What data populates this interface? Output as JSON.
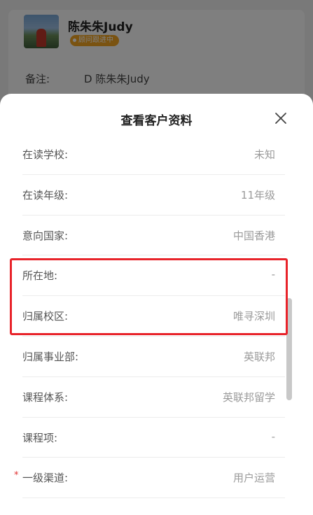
{
  "background": {
    "customer_name": "陈朱朱Judy",
    "status_badge": "顾问跟进中",
    "remark_label": "备注:",
    "remark_value": "D 陈朱朱Judy"
  },
  "sheet": {
    "title": "查看客户资料",
    "close_icon": "close-icon",
    "rows": [
      {
        "label": "在读学校:",
        "value": "未知",
        "required": false
      },
      {
        "label": "在读年级:",
        "value": "11年级",
        "required": false
      },
      {
        "label": "意向国家:",
        "value": "中国香港",
        "required": false
      },
      {
        "label": "所在地:",
        "value": "-",
        "required": false
      },
      {
        "label": "归属校区:",
        "value": "唯寻深圳",
        "required": false
      },
      {
        "label": "归属事业部:",
        "value": "英联邦",
        "required": false
      },
      {
        "label": "课程体系:",
        "value": "英联邦留学",
        "required": false
      },
      {
        "label": "课程项:",
        "value": "-",
        "required": false
      },
      {
        "label": "一级渠道:",
        "value": "用户运营",
        "required": true,
        "required_mark": "*"
      }
    ]
  },
  "colors": {
    "highlight": "#e8232a",
    "badge": "#f5a623",
    "required": "#e03030"
  }
}
